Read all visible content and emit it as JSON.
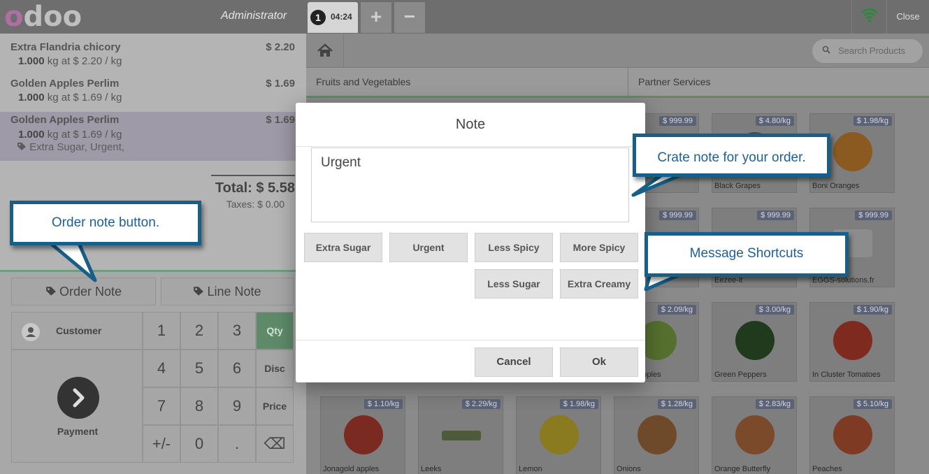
{
  "app": {
    "user": "Administrator",
    "close_label": "Close"
  },
  "order_tab": {
    "number": "1",
    "time": "04:24"
  },
  "tab_controls": {
    "add": "+",
    "remove": "−"
  },
  "order_lines": [
    {
      "name": "Extra Flandria chicory",
      "price": "$ 2.20",
      "qty": "1.000",
      "unit_info": "kg at $ 2.20 / kg",
      "note": ""
    },
    {
      "name": "Golden Apples Perlim",
      "price": "$ 1.69",
      "qty": "1.000",
      "unit_info": "kg at $ 1.69 / kg",
      "note": ""
    },
    {
      "name": "Golden Apples Perlim",
      "price": "$ 1.69",
      "qty": "1.000",
      "unit_info": "kg at $ 1.69 / kg",
      "note": "Extra Sugar, Urgent,"
    }
  ],
  "summary": {
    "total": "Total: $ 5.58",
    "taxes": "Taxes: $ 0.00"
  },
  "actions": {
    "order_note": "Order Note",
    "line_note": "Line Note"
  },
  "pad": {
    "customer": "Customer",
    "payment": "Payment",
    "keys": [
      "1",
      "2",
      "3",
      "4",
      "5",
      "6",
      "7",
      "8",
      "9",
      "+/-",
      "0",
      "."
    ],
    "modes": [
      "Qty",
      "Disc",
      "Price"
    ],
    "backspace": "⌫"
  },
  "search": {
    "placeholder": "Search Products"
  },
  "categories": [
    "Fruits and Vegetables",
    "Partner Services"
  ],
  "products": [
    {
      "name": "",
      "price": "$ 999.99"
    },
    {
      "name": "Black Grapes",
      "price": "$ 4.80/kg"
    },
    {
      "name": "Boni Oranges",
      "price": "$ 1.98/kg"
    },
    {
      "name": "",
      "price": "$ 999.99"
    },
    {
      "name": "Eezee-it",
      "price": "$ 999.99"
    },
    {
      "name": "EGGS-solutions.fr",
      "price": "$ 999.99"
    },
    {
      "name": "Smith apples",
      "price": "$ 2.09/kg"
    },
    {
      "name": "Green Peppers",
      "price": "$ 3.00/kg"
    },
    {
      "name": "In Cluster Tomatoes",
      "price": "$ 1.90/kg"
    },
    {
      "name": "Jonagold apples",
      "price": "$ 1.10/kg"
    },
    {
      "name": "Leeks",
      "price": "$ 2.29/kg"
    },
    {
      "name": "Lemon",
      "price": "$ 1.98/kg"
    },
    {
      "name": "Onions",
      "price": "$ 1.28/kg"
    },
    {
      "name": "Orange Butterfly",
      "price": "$ 2.83/kg"
    },
    {
      "name": "Peaches",
      "price": "$ 5.10/kg"
    }
  ],
  "modal": {
    "title": "Note",
    "value": "Urgent",
    "shortcuts": [
      "Extra Sugar",
      "Urgent",
      "Less Spicy",
      "More Spicy",
      "Less Sugar",
      "Extra Creamy"
    ],
    "cancel": "Cancel",
    "ok": "Ok"
  },
  "callouts": {
    "order_note": "Order note button.",
    "create_note": "Crate note for your order.",
    "shortcuts": "Message Shortcuts"
  },
  "colors": {
    "callout_border": "#175f86",
    "callout_text": "#1d5f95",
    "active_mode": "#5e8a6a",
    "price_tag": "#5c6276"
  },
  "icons": {
    "home": "home-icon",
    "search": "search-icon",
    "wifi": "wifi-icon",
    "tag": "tag-icon",
    "user": "user-icon",
    "payment": "chevron-right-icon"
  }
}
